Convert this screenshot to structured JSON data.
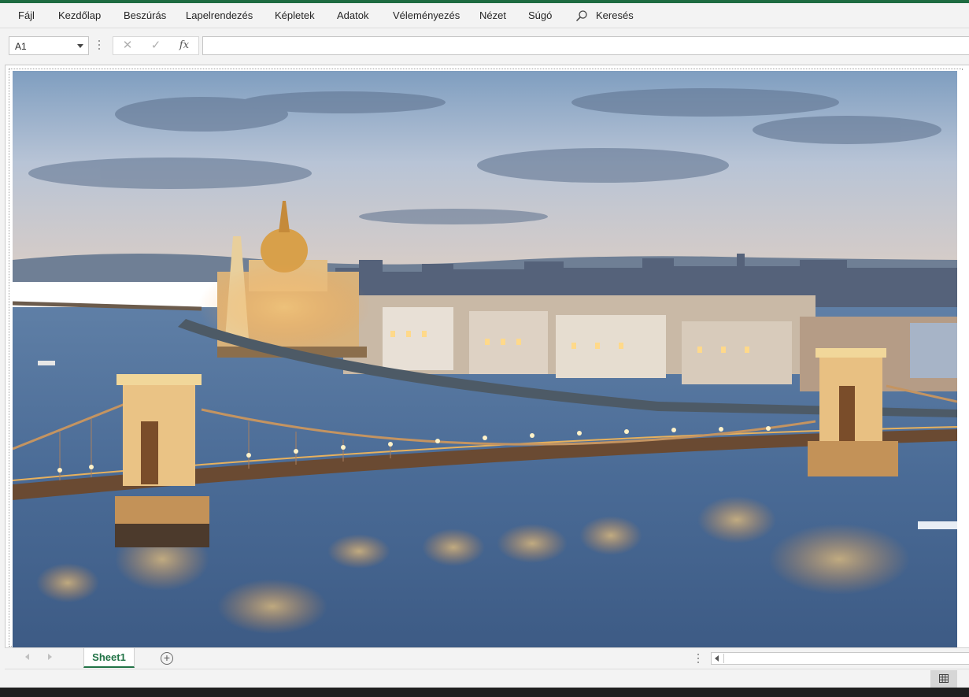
{
  "ribbon": {
    "tabs": [
      "Fájl",
      "Kezdőlap",
      "Beszúrás",
      "Lapelrendezés",
      "Képletek",
      "Adatok",
      "Véleményezés",
      "Nézet",
      "Súgó"
    ],
    "search_label": "Keresés",
    "search_icon": "search-icon"
  },
  "formula_bar": {
    "name_box": "A1",
    "cancel_symbol": "✕",
    "enter_symbol": "✓",
    "fx_symbol": "fx",
    "formula_value": ""
  },
  "picture": {
    "subject": "budapest-chain-bridge-parliament-dusk"
  },
  "sheet_tabs": {
    "tabs": [
      "Sheet1"
    ],
    "active": "Sheet1",
    "add_symbol": "+"
  },
  "status_bar": {
    "view": "normal-view-icon"
  },
  "colors": {
    "accent": "#217346",
    "top_accent": "#1e6b41",
    "chrome": "#f3f3f3"
  }
}
